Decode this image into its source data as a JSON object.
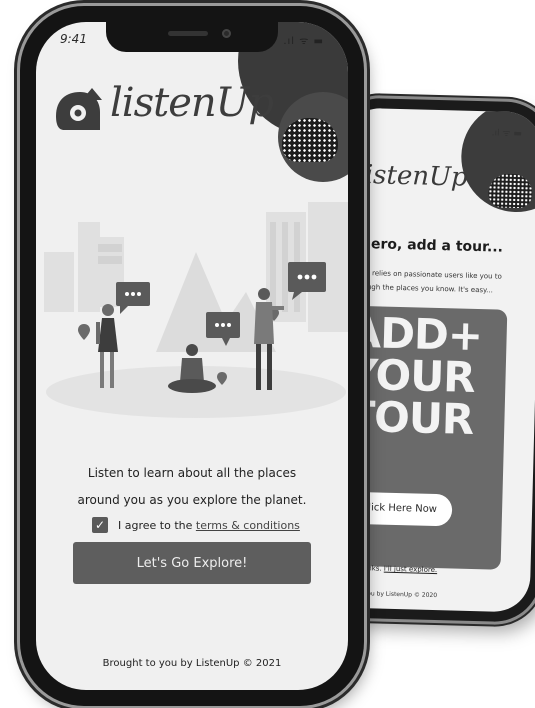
{
  "back_screen": {
    "headline": "hero, add a tour...",
    "body_line1": "rm relies on passionate users like you to",
    "body_line2": "rough the places you know. It's easy...",
    "card_line1": "ADD+",
    "card_line2": "YOUR",
    "card_line3": "TOUR",
    "cta_label": "Click Here Now",
    "no_thanks": "No Thanks.",
    "just_explore": "I'll just explore.",
    "footer": "ght to you by ListenUp © 2020",
    "logo_text": "istenUp"
  },
  "front_screen": {
    "status_time": "9:41",
    "logo_text": "listenUp",
    "tagline_line1": "Listen to learn about all the places",
    "tagline_line2": "around you as you explore the planet.",
    "agree_prefix": "I agree to the ",
    "agree_link": "terms & conditions",
    "checkbox_mark": "✓",
    "explore_label": "Let's Go Explore!",
    "footer": "Brought to you by ListenUp © 2021"
  },
  "colors": {
    "button": "#5e5e5e",
    "blob": "#3a3a3a",
    "background": "#f0f0f0"
  }
}
